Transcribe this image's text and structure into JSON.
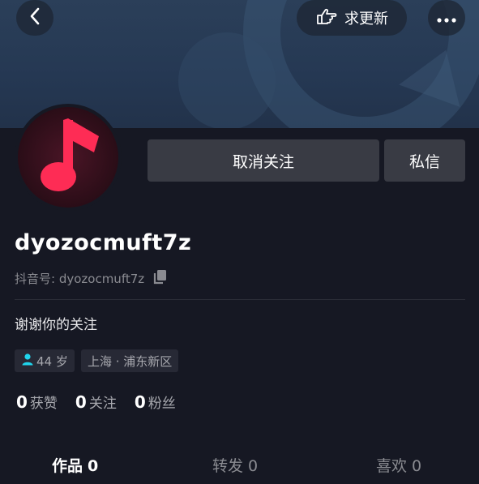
{
  "header": {
    "update_label": "求更新"
  },
  "actions": {
    "unfollow_label": "取消关注",
    "message_label": "私信"
  },
  "profile": {
    "username": "dyozocmuft7z",
    "douyin_id_label": "抖音号: dyozocmuft7z",
    "bio": "谢谢你的关注",
    "tags": {
      "age": "44 岁",
      "location": "上海 · 浦东新区"
    }
  },
  "stats": [
    {
      "value": "0",
      "label": "获赞"
    },
    {
      "value": "0",
      "label": "关注"
    },
    {
      "value": "0",
      "label": "粉丝"
    }
  ],
  "tabs": [
    {
      "label": "作品",
      "count": "0"
    },
    {
      "label": "转发",
      "count": "0"
    },
    {
      "label": "喜欢",
      "count": "0"
    }
  ],
  "colors": {
    "background": "#161823",
    "banner": "#253853",
    "avatar_accent": "#fe2c55",
    "age_icon": "#20d5ec",
    "button_bg": "#393b44"
  },
  "icons": {
    "back": "chevron-left-icon",
    "update": "pointing-hand-icon",
    "more": "more-dots-icon",
    "avatar": "music-note-icon",
    "copy": "copy-icon",
    "age": "person-icon"
  }
}
